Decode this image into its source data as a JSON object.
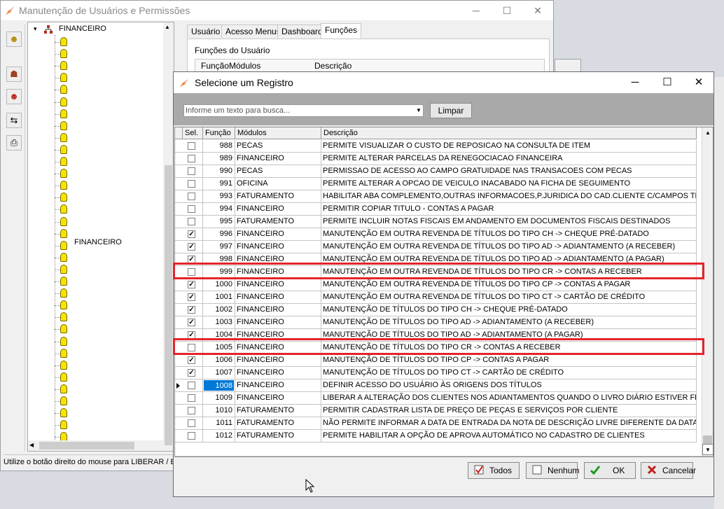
{
  "main_window": {
    "title": "Manutenção de Usuários e Permissões",
    "minimize": "─",
    "maximize": "☐",
    "close": "✕",
    "tree_root": "FINANCEIRO",
    "tree_group_label": "FINANCEIRO",
    "tabs": [
      {
        "label": "Usuário",
        "active": false
      },
      {
        "label": "Acesso Menus",
        "active": false
      },
      {
        "label": "Dashboard",
        "active": false
      },
      {
        "label": "Funções",
        "active": true
      }
    ],
    "funcs_label": "Funções do Usuário",
    "funcs_columns": [
      "Função",
      "Módulos",
      "Descrição"
    ],
    "status": "Utilize o botão direito do mouse para LIBERAR / BL"
  },
  "dialog": {
    "title": "Selecione um Registro",
    "minimize": "─",
    "maximize": "☐",
    "close": "✕",
    "search_placeholder": "Informe um texto para busca...",
    "clear_label": "Limpar",
    "columns": [
      "Sel.",
      "Função",
      "Módulos",
      "Descrição"
    ],
    "rows": [
      {
        "sel": false,
        "func": "988",
        "mod": "PECAS",
        "desc": "PERMITE VISUALIZAR O CUSTO DE REPOSICAO NA CONSULTA DE ITEM"
      },
      {
        "sel": false,
        "func": "989",
        "mod": "FINANCEIRO",
        "desc": "PERMITE ALTERAR PARCELAS DA RENEGOCIACAO FINANCEIRA"
      },
      {
        "sel": false,
        "func": "990",
        "mod": "PECAS",
        "desc": "PERMISSAO DE ACESSO AO CAMPO GRATUIDADE NAS TRANSACOES COM PECAS"
      },
      {
        "sel": false,
        "func": "991",
        "mod": "OFICINA",
        "desc": "PERMITE ALTERAR A OPCAO DE VEICULO INACABADO NA FICHA DE SEGUIMENTO"
      },
      {
        "sel": false,
        "func": "993",
        "mod": "FATURAMENTO",
        "desc": "HABILITAR ABA COMPLEMENTO,OUTRAS INFORMACOES,P.JURIDICA DO CAD.CLIENTE C/CAMPOS TRIB.E RI"
      },
      {
        "sel": false,
        "func": "994",
        "mod": "FINANCEIRO",
        "desc": "PERMITIR COPIAR TITULO - CONTAS A PAGAR"
      },
      {
        "sel": false,
        "func": "995",
        "mod": "FATURAMENTO",
        "desc": "PERMITE INCLUIR NOTAS FISCAIS EM ANDAMENTO EM DOCUMENTOS FISCAIS DESTINADOS"
      },
      {
        "sel": true,
        "func": "996",
        "mod": "FINANCEIRO",
        "desc": "MANUTENÇÃO EM OUTRA REVENDA DE TÍTULOS DO TIPO CH -> CHEQUE PRÉ-DATADO"
      },
      {
        "sel": true,
        "func": "997",
        "mod": "FINANCEIRO",
        "desc": "MANUTENÇÃO EM OUTRA REVENDA DE TÍTULOS DO TIPO AD -> ADIANTAMENTO (A RECEBER)"
      },
      {
        "sel": true,
        "func": "998",
        "mod": "FINANCEIRO",
        "desc": "MANUTENÇÃO EM OUTRA REVENDA DE TÍTULOS DO TIPO AD -> ADIANTAMENTO (A PAGAR)"
      },
      {
        "sel": false,
        "func": "999",
        "mod": "FINANCEIRO",
        "desc": "MANUTENÇÃO EM OUTRA REVENDA DE TÍTULOS DO TIPO CR -> CONTAS A RECEBER",
        "highlight": true
      },
      {
        "sel": true,
        "func": "1000",
        "mod": "FINANCEIRO",
        "desc": "MANUTENÇÃO EM OUTRA REVENDA DE TÍTULOS DO TIPO CP -> CONTAS A PAGAR"
      },
      {
        "sel": true,
        "func": "1001",
        "mod": "FINANCEIRO",
        "desc": "MANUTENÇÃO EM OUTRA REVENDA DE TÍTULOS DO TIPO CT -> CARTÃO DE CRÉDITO"
      },
      {
        "sel": true,
        "func": "1002",
        "mod": "FINANCEIRO",
        "desc": "MANUTENÇÃO DE TÍTULOS DO TIPO CH -> CHEQUE PRÉ-DATADO"
      },
      {
        "sel": true,
        "func": "1003",
        "mod": "FINANCEIRO",
        "desc": "MANUTENÇÃO DE TÍTULOS DO TIPO AD -> ADIANTAMENTO (A RECEBER)"
      },
      {
        "sel": true,
        "func": "1004",
        "mod": "FINANCEIRO",
        "desc": "MANUTENÇÃO DE TÍTULOS DO TIPO AD -> ADIANTAMENTO (A PAGAR)"
      },
      {
        "sel": false,
        "func": "1005",
        "mod": "FINANCEIRO",
        "desc": "MANUTENÇÃO DE TÍTULOS DO TIPO CR -> CONTAS A RECEBER",
        "highlight": true
      },
      {
        "sel": true,
        "func": "1006",
        "mod": "FINANCEIRO",
        "desc": "MANUTENÇÃO DE TÍTULOS DO TIPO CP -> CONTAS A PAGAR"
      },
      {
        "sel": true,
        "func": "1007",
        "mod": "FINANCEIRO",
        "desc": "MANUTENÇÃO DE TÍTULOS DO TIPO CT -> CARTÃO DE CRÉDITO"
      },
      {
        "sel": false,
        "func": "1008",
        "mod": "FINANCEIRO",
        "desc": "DEFINIR ACESSO DO USUÁRIO ÀS ORIGENS DOS TÍTULOS",
        "current": true
      },
      {
        "sel": false,
        "func": "1009",
        "mod": "FINANCEIRO",
        "desc": "LIBERAR A ALTERAÇÃO DOS CLIENTES NOS ADIANTAMENTOS QUANDO O LIVRO DIÁRIO ESTIVER FECHADO"
      },
      {
        "sel": false,
        "func": "1010",
        "mod": "FATURAMENTO",
        "desc": "PERMITIR CADASTRAR LISTA DE PREÇO DE PEÇAS E SERVIÇOS POR CLIENTE"
      },
      {
        "sel": false,
        "func": "1011",
        "mod": "FATURAMENTO",
        "desc": "NÃO PERMITE INFORMAR A DATA DE ENTRADA DA NOTA DE DESCRIÇÃO LIVRE DIFERENTE DA DATA ATUAL"
      },
      {
        "sel": false,
        "func": "1012",
        "mod": "FATURAMENTO",
        "desc": "PERMITE HABILITAR A OPÇÃO DE APROVA AUTOMÁTICO NO CADASTRO DE CLIENTES"
      }
    ],
    "buttons": {
      "todos": "Todos",
      "nenhum": "Nenhum",
      "ok": "OK",
      "cancelar": "Cancelar"
    }
  },
  "colors": {
    "highlight_box": "#e3242b",
    "selected_cell": "#0078d7"
  }
}
